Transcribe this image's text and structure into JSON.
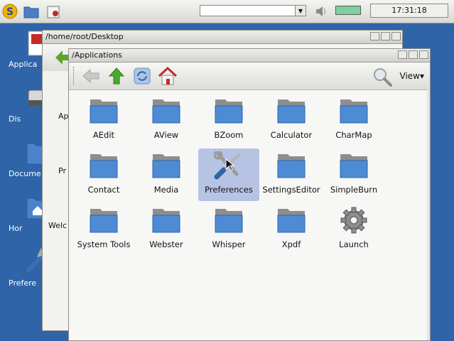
{
  "taskbar": {
    "search_value": "",
    "clock": "17:31:18"
  },
  "desktop": {
    "icons": [
      {
        "label": "Applica"
      },
      {
        "label": "Dis"
      },
      {
        "label": "Docume"
      },
      {
        "label": "Hor"
      },
      {
        "label": "Prefere"
      }
    ]
  },
  "back_window": {
    "title": "/home/root/Desktop",
    "items": [
      {
        "label": "Ap"
      },
      {
        "label": "Pr"
      },
      {
        "label": "Welc"
      }
    ]
  },
  "main_window": {
    "title": "/Applications",
    "view_label": "View▾",
    "items": [
      {
        "label": "AEdit",
        "icon": "folder-icon"
      },
      {
        "label": "AView",
        "icon": "folder-icon"
      },
      {
        "label": "BZoom",
        "icon": "folder-icon"
      },
      {
        "label": "Calculator",
        "icon": "folder-icon"
      },
      {
        "label": "CharMap",
        "icon": "folder-icon"
      },
      {
        "label": "Contact",
        "icon": "folder-icon"
      },
      {
        "label": "Media",
        "icon": "folder-icon"
      },
      {
        "label": "Preferences",
        "icon": "tools-icon",
        "selected": true
      },
      {
        "label": "SettingsEditor",
        "icon": "folder-icon"
      },
      {
        "label": "SimpleBurn",
        "icon": "folder-icon"
      },
      {
        "label": "System Tools",
        "icon": "folder-icon"
      },
      {
        "label": "Webster",
        "icon": "folder-icon"
      },
      {
        "label": "Whisper",
        "icon": "folder-icon"
      },
      {
        "label": "Xpdf",
        "icon": "folder-icon"
      },
      {
        "label": "Launch",
        "icon": "gear-icon"
      }
    ]
  }
}
